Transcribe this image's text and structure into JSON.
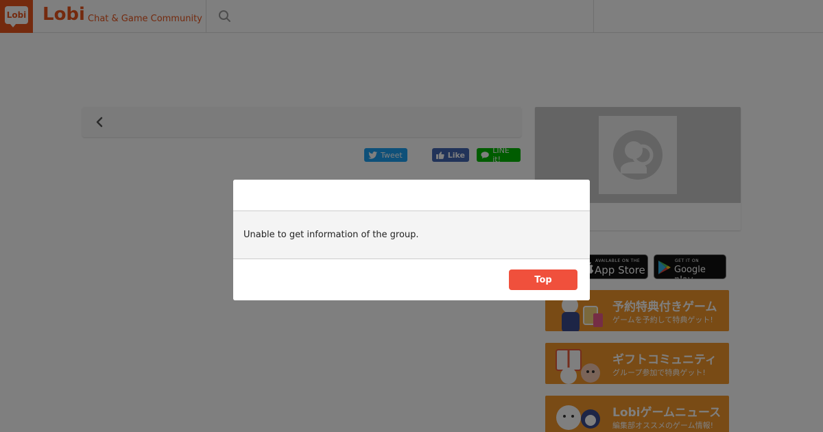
{
  "header": {
    "logo_text": "Lobi",
    "brand_name": "Lobi",
    "tagline": "Chat & Game Community"
  },
  "share": {
    "tweet_label": "Tweet",
    "like_label": "Like",
    "line_label": "LINE it!"
  },
  "sidebar": {
    "app_store": {
      "small": "AVAILABLE ON THE",
      "big": "App Store"
    },
    "google_play": {
      "small": "GET IT ON",
      "big": "Google play"
    },
    "promos": [
      {
        "title": "予約特典付きゲーム",
        "subtitle": "ゲームを予約して特典ゲット!"
      },
      {
        "title": "ギフトコミュニティ",
        "subtitle": "グループ参加で特典ゲット!"
      },
      {
        "title": "Lobiゲームニュース",
        "subtitle": "編集部オススメのゲーム情報!"
      }
    ]
  },
  "modal": {
    "message": "Unable to get information of the group.",
    "button_label": "Top"
  },
  "colors": {
    "brand": "#e8541c",
    "button": "#f0503c",
    "promo": "#f3962a",
    "tweet": "#1da1f2",
    "like": "#4267b2",
    "line": "#00b900"
  }
}
